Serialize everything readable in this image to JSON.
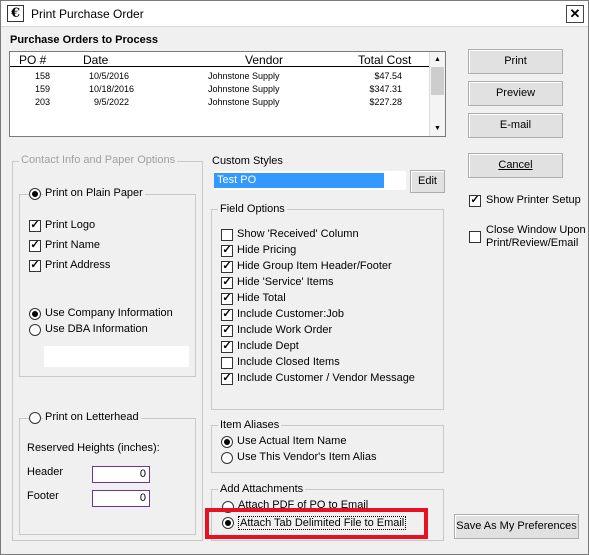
{
  "window": {
    "title": "Print Purchase Order"
  },
  "po_section": {
    "title": "Purchase Orders to Process",
    "columns": [
      "PO #",
      "Date",
      "Vendor",
      "Total Cost"
    ],
    "rows": [
      {
        "po": "158",
        "date": "10/5/2016",
        "vendor": "Johnstone Supply",
        "total": "$47.54"
      },
      {
        "po": "159",
        "date": "10/18/2016",
        "vendor": "Johnstone Supply",
        "total": "$347.31"
      },
      {
        "po": "203",
        "date": "9/5/2022",
        "vendor": "Johnstone Supply",
        "total": "$227.28"
      }
    ]
  },
  "buttons": {
    "print": "Print",
    "preview": "Preview",
    "email": "E-mail",
    "cancel": "Cancel",
    "edit": "Edit",
    "save_prefs": "Save As My Preferences"
  },
  "right_options": {
    "show_printer_setup": "Show Printer Setup",
    "close_window_line1": "Close Window Upon",
    "close_window_line2": "Print/Review/Email"
  },
  "contact_group": {
    "title": "Contact Info and Paper Options",
    "plain_paper": "Print on Plain Paper",
    "print_logo": "Print Logo",
    "print_name": "Print Name",
    "print_address": "Print Address",
    "use_company_info": "Use Company Information",
    "use_dba_info": "Use DBA Information",
    "letterhead": "Print on Letterhead",
    "reserved_heights": "Reserved Heights (inches):",
    "header_label": "Header",
    "header_value": "0",
    "footer_label": "Footer",
    "footer_value": "0"
  },
  "custom_styles": {
    "label": "Custom Styles",
    "selected": "Test PO"
  },
  "field_options": {
    "title": "Field Options",
    "items": [
      {
        "label": "Show 'Received' Column",
        "checked": false
      },
      {
        "label": "Hide Pricing",
        "checked": true
      },
      {
        "label": "Hide Group Item Header/Footer",
        "checked": true
      },
      {
        "label": "Hide 'Service' Items",
        "checked": true
      },
      {
        "label": "Hide Total",
        "checked": true
      },
      {
        "label": "Include Customer:Job",
        "checked": true
      },
      {
        "label": "Include Work Order",
        "checked": true
      },
      {
        "label": "Include Dept",
        "checked": true
      },
      {
        "label": "Include Closed Items",
        "checked": false
      },
      {
        "label": "Include Customer / Vendor Message",
        "checked": true
      }
    ]
  },
  "item_aliases": {
    "title": "Item Aliases",
    "use_actual": "Use Actual Item Name",
    "use_vendor": "Use This Vendor's Item Alias"
  },
  "attachments": {
    "title": "Add Attachments",
    "attach_pdf": "Attach PDF of PO to Email",
    "attach_tab": "Attach Tab Delimited File to Email"
  },
  "colors": {
    "highlight": "#3399ff",
    "callout": "#e81123"
  }
}
